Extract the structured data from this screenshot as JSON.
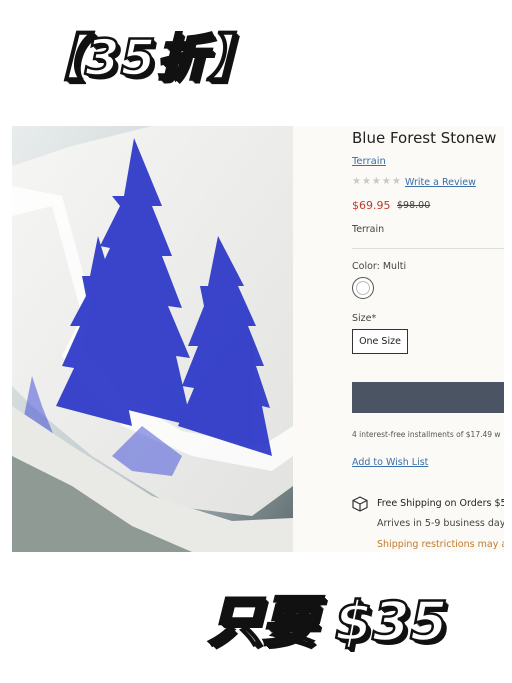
{
  "overlay": {
    "top_banner": "【35折】",
    "bottom_banner": "只要 $35"
  },
  "product": {
    "title": "Blue Forest Stonew",
    "brand_link": "Terrain",
    "stars": "★★★★★",
    "review_link": "Write a Review",
    "price": "$69.95",
    "original_price": "$98.00",
    "vendor": "Terrain",
    "color_label": "Color: Multi",
    "size_label": "Size*",
    "size_option": "One Size",
    "installments": "4 interest-free installments of $17.49 w",
    "wishlist_link": "Add to Wish List",
    "shipping_title": "Free Shipping on Orders $5",
    "shipping_arrives": "Arrives in 5-9 business days",
    "shipping_restrictions": "Shipping restrictions may ap"
  },
  "colors": {
    "cart_button": "#4b5462",
    "sale_price": "#c0392b",
    "link": "#3a6fa8",
    "restriction_text": "#c47a2c",
    "tree_blue": "#2a36c8"
  },
  "icons": {
    "shipping": "box-icon",
    "rating": "star-icon"
  }
}
